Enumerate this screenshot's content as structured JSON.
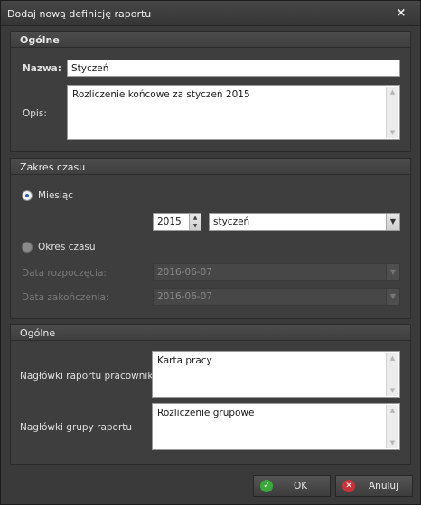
{
  "window": {
    "title": "Dodaj nową definicję raportu",
    "close_glyph": "×"
  },
  "general": {
    "header": "Ogólne",
    "name_label": "Nazwa:",
    "name_value": "Styczeń",
    "desc_label": "Opis:",
    "desc_value": "Rozliczenie końcowe za styczeń 2015"
  },
  "timerange": {
    "header": "Zakres czasu",
    "month_label": "Miesiąc",
    "month_selected": true,
    "year_value": "2015",
    "month_value": "styczeń",
    "period_label": "Okres czasu",
    "period_selected": false,
    "start_label": "Data rozpoczęcia:",
    "start_value": "2016-06-07",
    "end_label": "Data zakończenia:",
    "end_value": "2016-06-07"
  },
  "general2": {
    "header": "Ogólne",
    "employee_headers_label": "Nagłówki raportu pracownika",
    "employee_headers_value": "Karta pracy",
    "group_headers_label": "Nagłówki grupy raportu",
    "group_headers_value": "Rozliczenie grupowe"
  },
  "buttons": {
    "ok_label": "OK",
    "cancel_label": "Anuluj",
    "ok_icon": "check-circle-icon",
    "cancel_icon": "x-circle-icon",
    "ok_icon_color": "#3aa83a",
    "cancel_icon_color": "#c9333a"
  }
}
